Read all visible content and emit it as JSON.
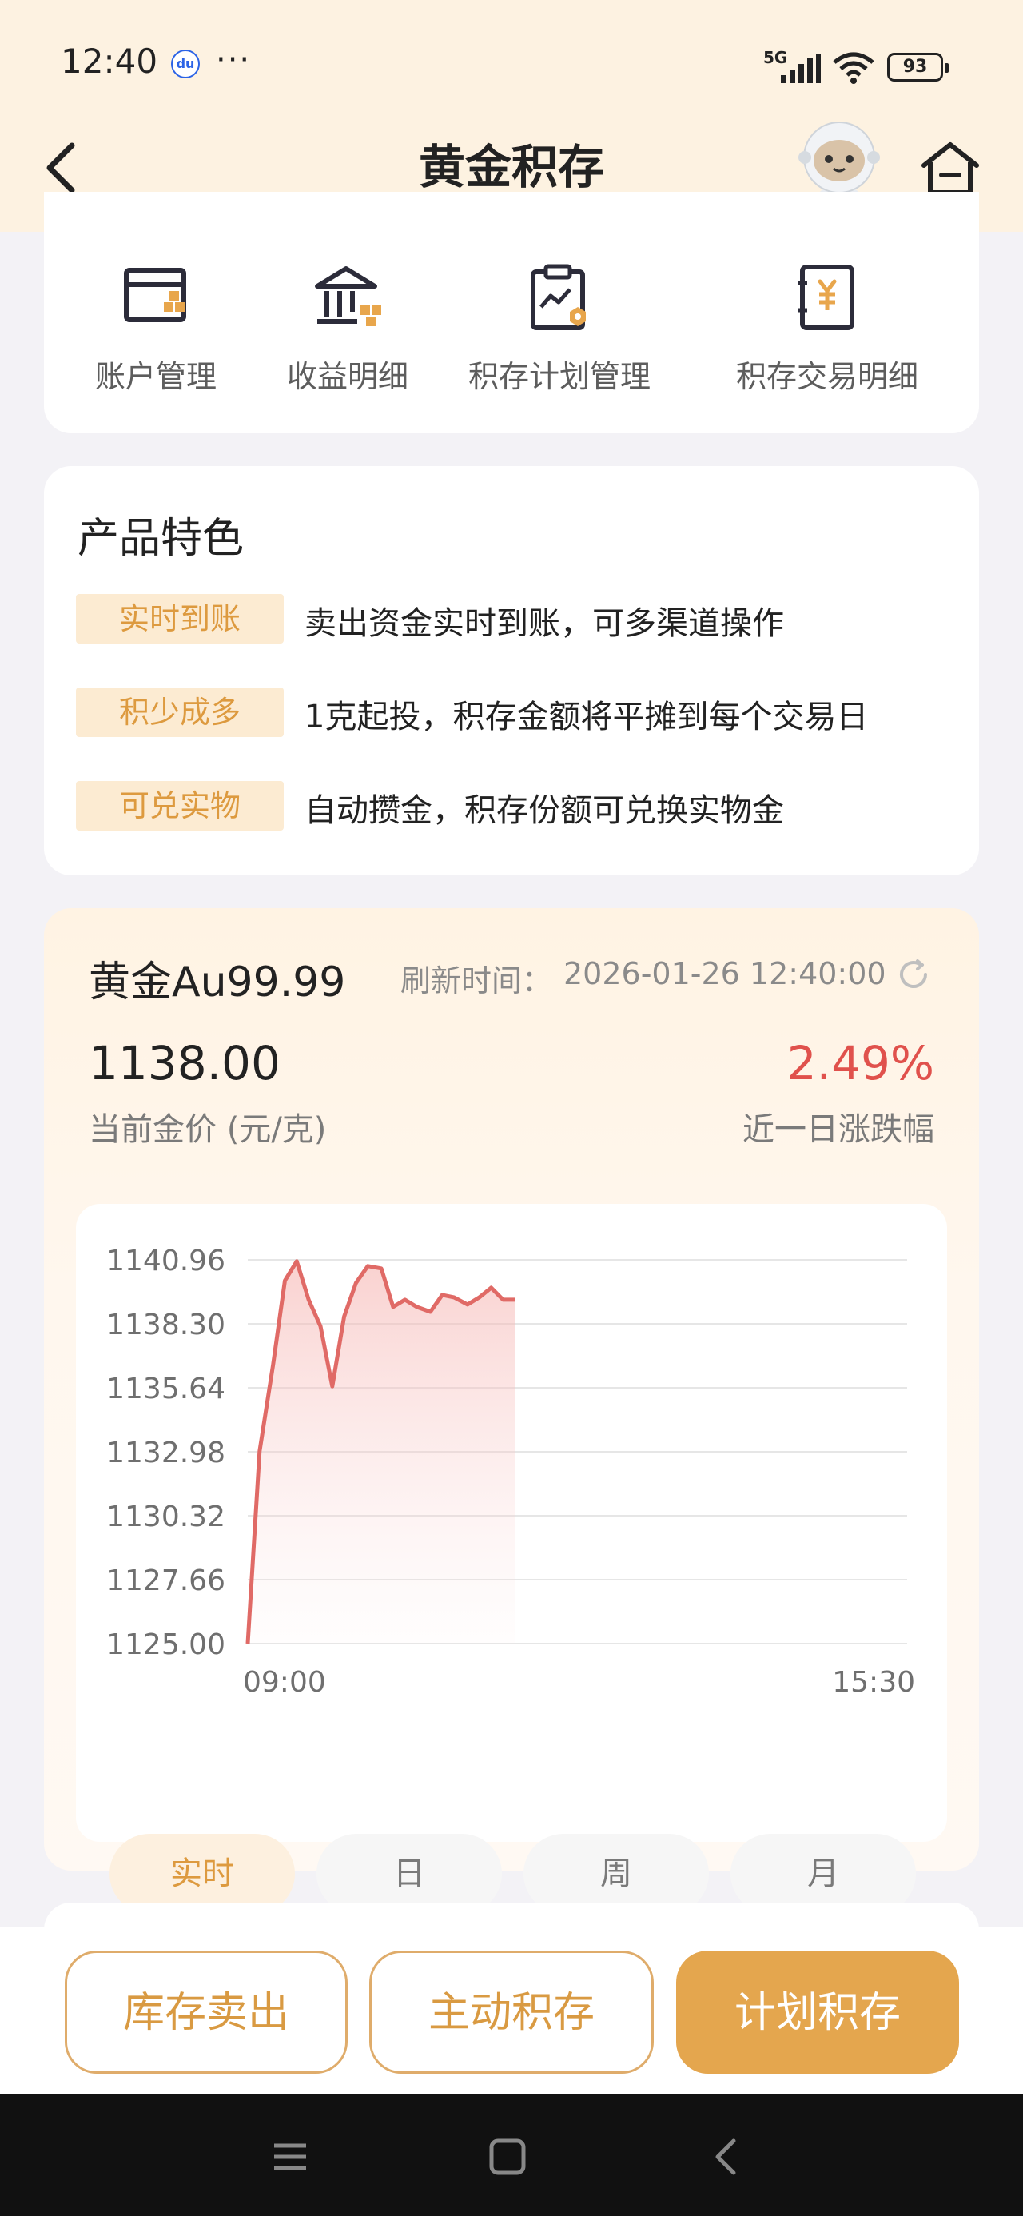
{
  "status_bar": {
    "time": "12:40",
    "baidu_icon_text": "du",
    "more_dots": "···",
    "network": "5G",
    "battery": "93"
  },
  "nav": {
    "title": "黄金积存",
    "back_icon": "chevron-left-icon",
    "home_icon": "home-icon"
  },
  "menu": {
    "items": [
      {
        "label": "账户管理",
        "icon": "account-card-icon"
      },
      {
        "label": "收益明细",
        "icon": "bank-icon"
      },
      {
        "label": "积存计划管理",
        "icon": "plan-clipboard-icon"
      },
      {
        "label": "积存交易明细",
        "icon": "yuan-notebook-icon"
      }
    ]
  },
  "features": {
    "title": "产品特色",
    "items": [
      {
        "tag": "实时到账",
        "text": "卖出资金实时到账，可多渠道操作"
      },
      {
        "tag": "积少成多",
        "text": "1克起投，积存金额将平摊到每个交易日"
      },
      {
        "tag": "可兑实物",
        "text": "自动攒金，积存份额可兑换实物金"
      }
    ]
  },
  "price": {
    "name": "黄金Au99.99",
    "refresh_label": "刷新时间：",
    "refresh_time": "2026-01-26 12:40:00",
    "current": "1138.00",
    "current_label": "当前金价 (元/克)",
    "change": "2.49%",
    "change_label": "近一日涨跌幅",
    "accent": "#e0514c",
    "gold": "#dd9a3f"
  },
  "chart_data": {
    "type": "area",
    "title": "",
    "xlabel": "",
    "ylabel": "",
    "x_ticks": [
      "09:00",
      "15:30"
    ],
    "y_ticks": [
      "1140.96",
      "1138.30",
      "1135.64",
      "1132.98",
      "1130.32",
      "1127.66",
      "1125.00"
    ],
    "ylim": [
      1125.0,
      1140.96
    ],
    "x_range_minutes": [
      0,
      390
    ],
    "series": [
      {
        "x_minutes": [
          0,
          7,
          15,
          22,
          29,
          36,
          43,
          50,
          57,
          64,
          71,
          79,
          86,
          93,
          100,
          108,
          115,
          122,
          130,
          137,
          144,
          151,
          158
        ],
        "y": [
          1125.0,
          1133.0,
          1136.6,
          1140.1,
          1140.9,
          1139.3,
          1138.2,
          1135.7,
          1138.6,
          1140.0,
          1140.7,
          1140.6,
          1139.0,
          1139.3,
          1139.0,
          1138.8,
          1139.5,
          1139.4,
          1139.1,
          1139.4,
          1139.8,
          1139.3,
          1139.3
        ]
      }
    ],
    "line_color": "#e06a66",
    "grid": true
  },
  "range_tabs": [
    {
      "label": "实时",
      "active": true
    },
    {
      "label": "日",
      "active": false
    },
    {
      "label": "周",
      "active": false
    },
    {
      "label": "月",
      "active": false
    }
  ],
  "actions": {
    "sell": "库存卖出",
    "active_save": "主动积存",
    "plan_save": "计划积存"
  },
  "system_nav": {
    "menu_icon": "menu-icon",
    "home_icon": "square-home-icon",
    "back_icon": "back-triangle-icon"
  }
}
